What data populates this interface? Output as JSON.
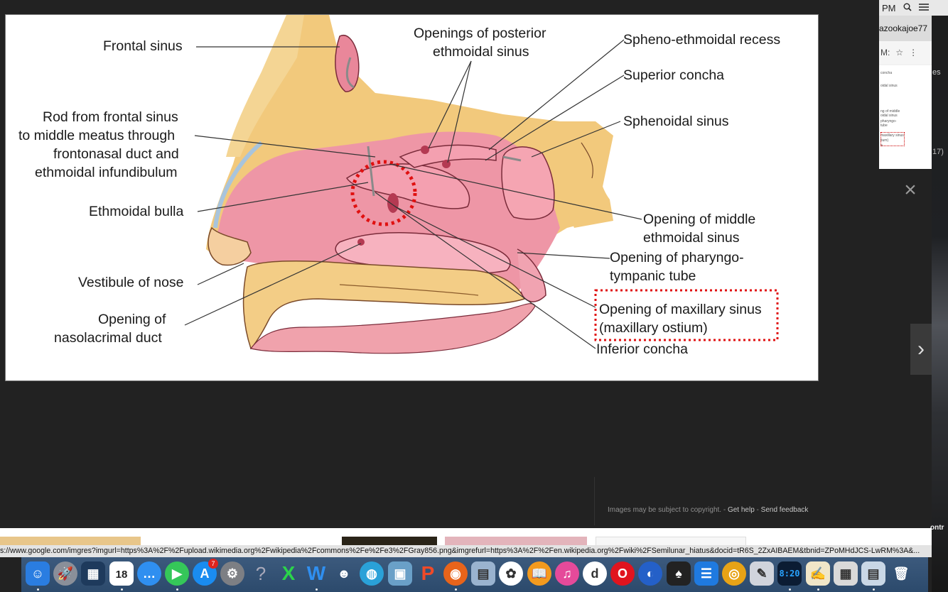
{
  "menubar": {
    "time": "PM",
    "search_icon": "search-icon",
    "list_icon": "list-icon"
  },
  "browser_tab": {
    "title": "azookajoe77"
  },
  "browser_toolbar": {
    "text": "M:",
    "star": "☆",
    "menu": "⋮"
  },
  "mini_preview": {
    "lines": [
      "concha",
      "oidal sinus",
      "ng of middle",
      "oidal sinus",
      "pharyngo-",
      "tube",
      "maxillary sinus",
      "tium)",
      "a"
    ]
  },
  "bg_text": {
    "es": "es",
    "count": "17)",
    "contr": "ontr"
  },
  "diagram": {
    "labels": {
      "frontal_sinus": "Frontal sinus",
      "rod_1": "Rod from frontal sinus",
      "rod_2": "to middle meatus through",
      "rod_3": "frontonasal duct and",
      "rod_4": "ethmoidal infundibulum",
      "ethmoidal_bulla": "Ethmoidal bulla",
      "vestibule": "Vestibule of nose",
      "nasolacrimal_1": "Opening of",
      "nasolacrimal_2": "nasolacrimal duct",
      "posterior_1": "Openings of posterior",
      "posterior_2": "ethmoidal sinus",
      "spheno_ethmoidal": "Spheno-ethmoidal recess",
      "superior_concha": "Superior concha",
      "sphenoidal_sinus": "Sphenoidal sinus",
      "middle_1": "Opening of middle",
      "middle_2": "ethmoidal sinus",
      "pharyngo_1": "Opening of pharyngo-",
      "pharyngo_2": "tympanic tube",
      "maxillary_1": "Opening of maxillary sinus",
      "maxillary_2": "(maxillary ostium)",
      "inferior_concha": "Inferior concha"
    }
  },
  "lightbox": {
    "close": "×",
    "next": "›"
  },
  "footer": {
    "notice": "Images may be subject to copyright.",
    "sep": " - ",
    "get_help": "Get help",
    "send_feedback": "Send feedback"
  },
  "status_url": "s://www.google.com/imgres?imgurl=https%3A%2F%2Fupload.wikimedia.org%2Fwikipedia%2Fcommons%2Fe%2Fe3%2FGray856.png&imgrefurl=https%3A%2F%2Fen.wikipedia.org%2Fwiki%2FSemilunar_hiatus&docid=tR6S_2ZxAIBAEM&tbnid=ZPoMHdJCS-LwRM%3A&...",
  "dock": {
    "calendar_day": "18",
    "calendar_month": "JUL",
    "appstore_badge": "7",
    "help_glyph": "?",
    "clock": "8:20",
    "items": [
      {
        "name": "finder-icon",
        "glyph": "☺",
        "color": "#2a7de1"
      },
      {
        "name": "launchpad-icon",
        "glyph": "🚀",
        "color": "#8a8f99"
      },
      {
        "name": "mission-control-icon",
        "glyph": "▦",
        "color": "#1e3a5c"
      },
      {
        "name": "calendar-icon",
        "glyph": "",
        "color": "#ffffff"
      },
      {
        "name": "messages-icon",
        "glyph": "…",
        "color": "#2f8ff0"
      },
      {
        "name": "facetime-icon",
        "glyph": "▶",
        "color": "#35c759"
      },
      {
        "name": "app-store-icon",
        "glyph": "A",
        "color": "#1a8cf0"
      },
      {
        "name": "system-preferences-icon",
        "glyph": "⚙",
        "color": "#7d7f84"
      },
      {
        "name": "help-icon",
        "glyph": "",
        "color": "transparent"
      },
      {
        "name": "excel-icon",
        "glyph": "X",
        "color": "transparent"
      },
      {
        "name": "word-icon",
        "glyph": "W",
        "color": "transparent"
      },
      {
        "name": "contacts-icon",
        "glyph": "☻",
        "color": "transparent"
      },
      {
        "name": "network-icon",
        "glyph": "◍",
        "color": "#2aa1d8"
      },
      {
        "name": "preview-icon",
        "glyph": "▣",
        "color": "#6aa0c8"
      },
      {
        "name": "powerpoint-icon",
        "glyph": "P",
        "color": "transparent"
      },
      {
        "name": "firefox-icon",
        "glyph": "◉",
        "color": "#e8641b"
      },
      {
        "name": "image-capture-icon",
        "glyph": "▤",
        "color": "#9ab3cf"
      },
      {
        "name": "photos-icon",
        "glyph": "✿",
        "color": "#ffffff"
      },
      {
        "name": "ibooks-icon",
        "glyph": "📖",
        "color": "#f39a1e"
      },
      {
        "name": "itunes-icon",
        "glyph": "♫",
        "color": "#e54a9a"
      },
      {
        "name": "dictionary-icon",
        "glyph": "d",
        "color": "#ffffff"
      },
      {
        "name": "opera-icon",
        "glyph": "O",
        "color": "#e0141e"
      },
      {
        "name": "firefox-alt-icon",
        "glyph": "◐",
        "color": "#2460c8"
      },
      {
        "name": "spades-icon",
        "glyph": "♠",
        "color": "#222222"
      },
      {
        "name": "notes-list-icon",
        "glyph": "☰",
        "color": "#1f7ae0"
      },
      {
        "name": "chrome-icon",
        "glyph": "◎",
        "color": "#e8a316"
      },
      {
        "name": "brush-icon",
        "glyph": "✎",
        "color": "#d0d4dc"
      },
      {
        "name": "clock-icon",
        "glyph": "",
        "color": "#0b1c33"
      },
      {
        "name": "textedit-icon",
        "glyph": "✍",
        "color": "#f0e6c8"
      },
      {
        "name": "calculator-grid-icon",
        "glyph": "▦",
        "color": "#d9d9d9"
      },
      {
        "name": "preview-doc-icon",
        "glyph": "▤",
        "color": "#c9d7e6"
      },
      {
        "name": "trash-icon",
        "glyph": "🗑",
        "color": "transparent"
      }
    ]
  }
}
